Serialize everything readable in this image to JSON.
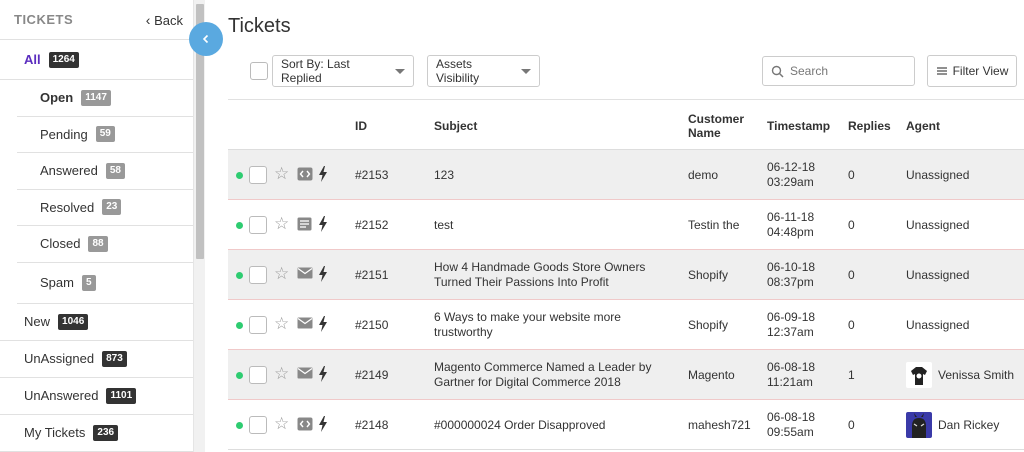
{
  "sidebar": {
    "title": "TICKETS",
    "back_label": "Back",
    "all": {
      "label": "All",
      "count": "1264"
    },
    "sub_items": [
      {
        "label": "Open",
        "count": "1147"
      },
      {
        "label": "Pending",
        "count": "59"
      },
      {
        "label": "Answered",
        "count": "58"
      },
      {
        "label": "Resolved",
        "count": "23"
      },
      {
        "label": "Closed",
        "count": "88"
      },
      {
        "label": "Spam",
        "count": "5"
      }
    ],
    "top_items": [
      {
        "label": "New",
        "count": "1046"
      },
      {
        "label": "UnAssigned",
        "count": "873"
      },
      {
        "label": "UnAnswered",
        "count": "1101"
      },
      {
        "label": "My Tickets",
        "count": "236"
      }
    ]
  },
  "main": {
    "title": "Tickets",
    "sort_label": "Sort By: Last Replied",
    "assets_label": "Assets Visibility",
    "search_placeholder": "Search",
    "filter_label": "Filter View"
  },
  "table": {
    "headers": {
      "id": "ID",
      "subject": "Subject",
      "customer_line1": "Customer",
      "customer_line2": "Name",
      "timestamp": "Timestamp",
      "replies": "Replies",
      "agent": "Agent"
    },
    "rows": [
      {
        "id": "#2153",
        "subject1": "123",
        "subject2": "",
        "customer": "demo",
        "date": "06-12-18",
        "time": "03:29am",
        "replies": "0",
        "agent": "Unassigned",
        "type_icon": "code-icon"
      },
      {
        "id": "#2152",
        "subject1": "test",
        "subject2": "",
        "customer": "Testin the",
        "date": "06-11-18",
        "time": "04:48pm",
        "replies": "0",
        "agent": "Unassigned",
        "type_icon": "form-icon"
      },
      {
        "id": "#2151",
        "subject1": "How 4 Handmade Goods Store Owners",
        "subject2": "Turned Their Passions Into Profit",
        "customer": "Shopify",
        "date": "06-10-18",
        "time": "08:37pm",
        "replies": "0",
        "agent": "Unassigned",
        "type_icon": "mail-icon"
      },
      {
        "id": "#2150",
        "subject1": "6 Ways to make your website more",
        "subject2": "trustworthy",
        "customer": "Shopify",
        "date": "06-09-18",
        "time": "12:37am",
        "replies": "0",
        "agent": "Unassigned",
        "type_icon": "mail-icon"
      },
      {
        "id": "#2149",
        "subject1": "Magento Commerce Named a Leader by",
        "subject2": "Gartner for Digital Commerce 2018",
        "customer": "Magento",
        "date": "06-08-18",
        "time": "11:21am",
        "replies": "1",
        "agent": "Venissa Smith",
        "type_icon": "mail-icon"
      },
      {
        "id": "#2148",
        "subject1": "#000000024 Order Disapproved",
        "subject2": "",
        "customer": "mahesh721",
        "date": "06-08-18",
        "time": "09:55am",
        "replies": "0",
        "agent": "Dan Rickey",
        "type_icon": "code-icon"
      }
    ]
  },
  "colors": {
    "accent_purple": "#5b2dbf",
    "collapse_button": "#5aa9e0",
    "online_dot": "#2ecc71"
  }
}
